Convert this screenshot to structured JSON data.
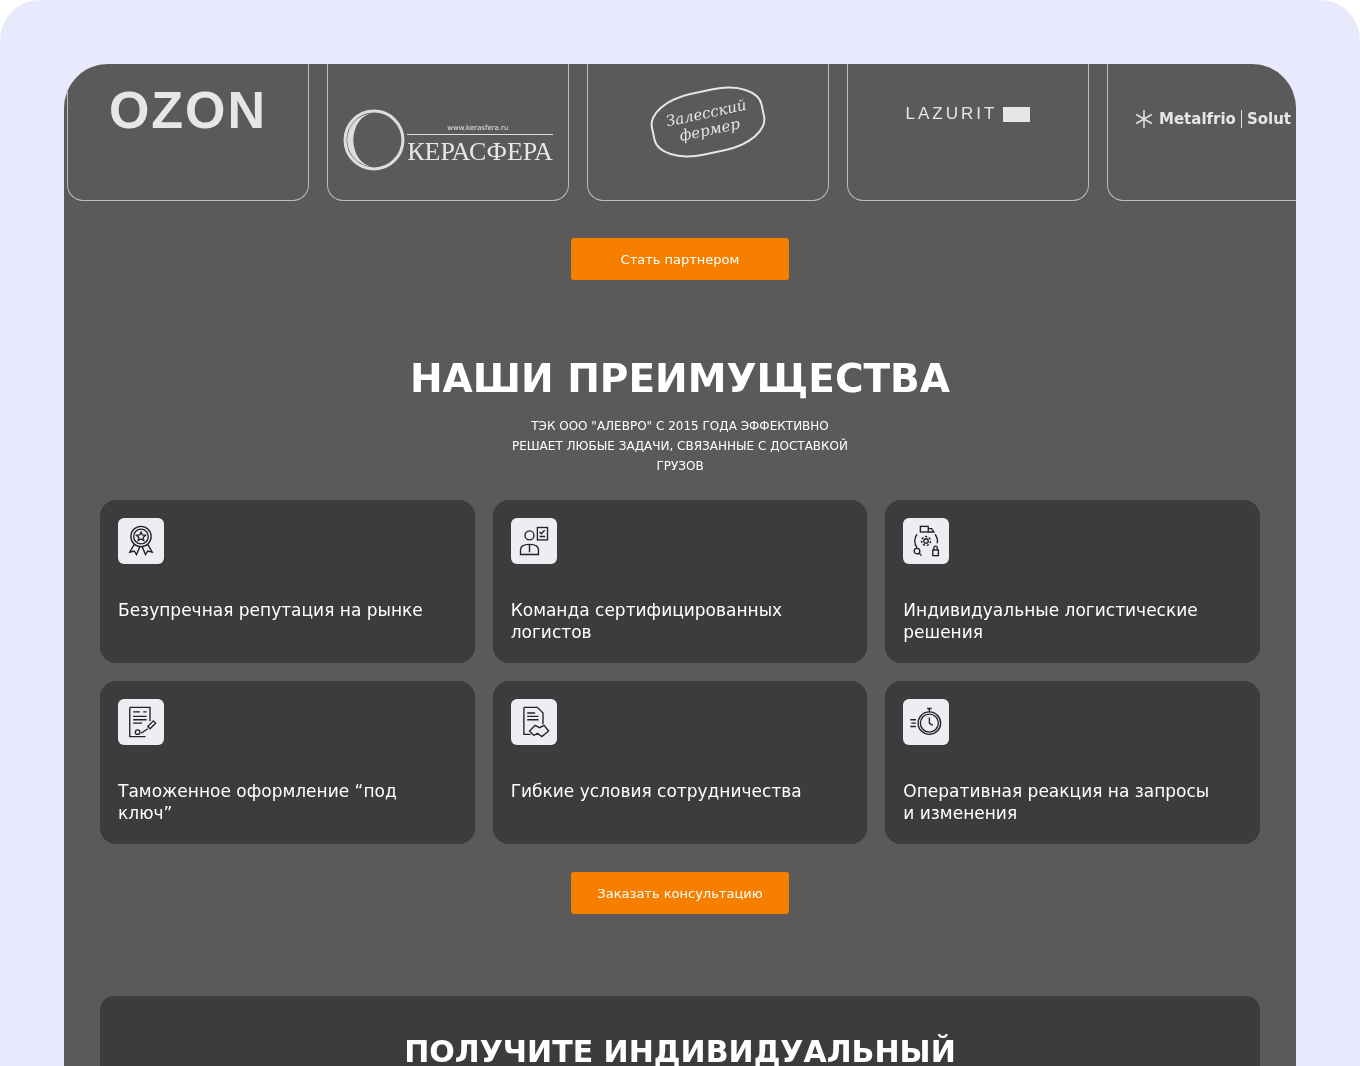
{
  "partners": [
    {
      "kind": "ozon",
      "texts": [
        "OZON"
      ]
    },
    {
      "kind": "kerasfera",
      "texts": [
        "www.kerasfera.ru",
        "КЕРАСФЕРА"
      ]
    },
    {
      "kind": "farmer",
      "texts": [
        "Залесский",
        "фермер"
      ]
    },
    {
      "kind": "lazurit",
      "texts": [
        "LAZURIT"
      ]
    },
    {
      "kind": "metalfrio",
      "texts": [
        "Metalfrio",
        "Solut"
      ]
    }
  ],
  "partner_button": "Стать партнером",
  "advantages": {
    "title": "НАШИ ПРЕИМУЩЕСТВА",
    "subtitle": "ТЭК ООО \"АЛЕВРО\" С 2015 ГОДА ЭФФЕКТИВНО РЕШАЕТ ЛЮБЫЕ ЗАДАЧИ, СВЯЗАННЫЕ С ДОСТАВКОЙ ГРУЗОВ",
    "cards": [
      {
        "kind": "medal",
        "text": "Безупречная репутация на рынке"
      },
      {
        "kind": "specialist",
        "text": "Команда сертифицированных логистов"
      },
      {
        "kind": "logistics",
        "text": "Индивидуальные логистические решения"
      },
      {
        "kind": "stamp",
        "text": "Таможенное оформление “под ключ”"
      },
      {
        "kind": "handshake",
        "text": "Гибкие условия сотрудничества"
      },
      {
        "kind": "stopwatch",
        "text": "Оперативная реакция на запросы и изменения"
      }
    ],
    "button": "Заказать консультацию"
  },
  "offer": {
    "title": "ПОЛУЧИТЕ ИНДИВИДУАЛЬНЫЙ"
  }
}
